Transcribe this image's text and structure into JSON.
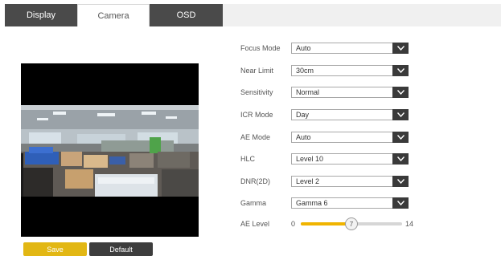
{
  "tabs": [
    {
      "label": "Display",
      "active": false
    },
    {
      "label": "Camera",
      "active": true
    },
    {
      "label": "OSD",
      "active": false
    }
  ],
  "settings": [
    {
      "label": "Focus Mode",
      "value": "Auto"
    },
    {
      "label": "Near Limit",
      "value": "30cm"
    },
    {
      "label": "Sensitivity",
      "value": "Normal"
    },
    {
      "label": "ICR Mode",
      "value": "Day"
    },
    {
      "label": "AE Mode",
      "value": "Auto"
    },
    {
      "label": "HLC",
      "value": "Level 10"
    },
    {
      "label": "DNR(2D)",
      "value": "Level 2"
    },
    {
      "label": "Gamma",
      "value": "Gamma 6"
    }
  ],
  "ae_level": {
    "label": "AE Level",
    "min": "0",
    "max": "14",
    "value": 7,
    "value_label": "7",
    "fraction": 0.5
  },
  "buttons": {
    "save": "Save",
    "default": "Default"
  },
  "colors": {
    "accent": "#f0b400",
    "dark": "#3d3d3d",
    "save": "#e2b714"
  },
  "icons": {
    "select_arrow": "chevron-down-icon"
  }
}
